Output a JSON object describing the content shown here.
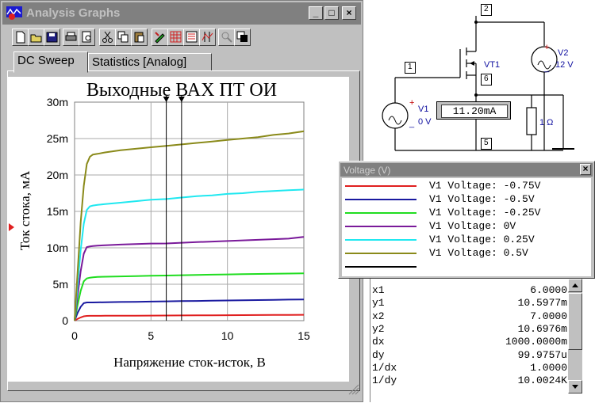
{
  "window": {
    "title": "Analysis Graphs",
    "controls": [
      "_",
      "□",
      "×"
    ]
  },
  "toolbar": {
    "icons": [
      "new-icon",
      "open-icon",
      "save-icon",
      "print-icon",
      "print-preview-icon",
      "cut-icon",
      "copy-icon",
      "paste-icon",
      "properties-icon",
      "grid-icon",
      "legend-icon",
      "cursors-icon",
      "zoom-icon",
      "overlay-icon"
    ]
  },
  "tabs": [
    {
      "label": "DC Sweep",
      "active": true
    },
    {
      "label": "Statistics [Analog]",
      "active": false
    }
  ],
  "chart_data": {
    "type": "line",
    "title": "Выходные ВАХ  ПТ ОИ",
    "xlabel": "Напряжение сток-исток, В",
    "ylabel": "Ток стока, мА",
    "xlim": [
      0,
      15
    ],
    "ylim": [
      0,
      0.03
    ],
    "xticks": [
      "0",
      "5",
      "10",
      "15"
    ],
    "yticks": [
      "0",
      "5m",
      "10m",
      "15m",
      "20m",
      "25m",
      "30m"
    ],
    "grid": true,
    "cursors": [
      6.0,
      7.0
    ],
    "x": [
      0,
      0.2,
      0.4,
      0.6,
      0.8,
      1.0,
      1.2,
      1.5,
      2,
      3,
      4,
      5,
      6,
      7,
      8,
      9,
      10,
      11,
      12,
      13,
      14,
      15
    ],
    "series": [
      {
        "name": "V1 Voltage: -0.75V",
        "color": "#e02020",
        "values": [
          0,
          0.00025,
          0.00045,
          0.0006,
          0.00065,
          0.00066,
          0.00066,
          0.00066,
          0.00067,
          0.00068,
          0.00069,
          0.0007,
          0.00071,
          0.00072,
          0.00073,
          0.00074,
          0.00075,
          0.00076,
          0.00077,
          0.00078,
          0.00079,
          0.0008
        ]
      },
      {
        "name": "V1 Voltage: -0.5V",
        "color": "#1a1aa0",
        "values": [
          0,
          0.0011,
          0.0019,
          0.0024,
          0.0025,
          0.0025,
          0.0025,
          0.00251,
          0.00253,
          0.00256,
          0.00259,
          0.00262,
          0.00265,
          0.00268,
          0.00271,
          0.00274,
          0.00277,
          0.0028,
          0.00283,
          0.00286,
          0.00289,
          0.0029
        ]
      },
      {
        "name": "V1 Voltage: -0.25V",
        "color": "#20dd20",
        "values": [
          0,
          0.0022,
          0.0041,
          0.0054,
          0.0058,
          0.0059,
          0.00595,
          0.006,
          0.00603,
          0.00608,
          0.00612,
          0.00617,
          0.0062,
          0.00624,
          0.00628,
          0.00631,
          0.00635,
          0.00638,
          0.00641,
          0.00644,
          0.00647,
          0.0065
        ]
      },
      {
        "name": "V1 Voltage: 0V",
        "color": "#7a1a9a",
        "values": [
          0,
          0.0035,
          0.0068,
          0.0092,
          0.0101,
          0.0102,
          0.01025,
          0.0103,
          0.01035,
          0.01045,
          0.01052,
          0.01059,
          0.0106,
          0.0107,
          0.01078,
          0.01086,
          0.01094,
          0.01102,
          0.0111,
          0.01118,
          0.01126,
          0.0115
        ]
      },
      {
        "name": "V1 Voltage: 0.25V",
        "color": "#20e8f0",
        "values": [
          0,
          0.005,
          0.0097,
          0.0133,
          0.0152,
          0.0157,
          0.0158,
          0.0159,
          0.016,
          0.0162,
          0.0164,
          0.0166,
          0.0167,
          0.0169,
          0.0171,
          0.0172,
          0.0174,
          0.0175,
          0.0177,
          0.0178,
          0.0179,
          0.018
        ]
      },
      {
        "name": "V1 Voltage: 0.5V",
        "color": "#8a8a1a",
        "values": [
          0,
          0.0068,
          0.0135,
          0.0185,
          0.0215,
          0.0225,
          0.0228,
          0.0229,
          0.0231,
          0.0234,
          0.0236,
          0.0238,
          0.024,
          0.0242,
          0.0244,
          0.0246,
          0.0248,
          0.025,
          0.0252,
          0.0255,
          0.0257,
          0.026
        ]
      }
    ]
  },
  "schematic": {
    "nodes": [
      "2",
      "1",
      "6",
      "5"
    ],
    "vt1": "VT1",
    "v1_name": "V1",
    "v1_value": "0 V",
    "v2_name": "V2",
    "v2_value": "12 V",
    "resistor": "1 Ω",
    "meter": "11.20mA",
    "plus": "+",
    "minus": "_"
  },
  "legend": {
    "title": "Voltage (V)",
    "close": "×",
    "items": [
      {
        "label": "V1 Voltage: -0.75V",
        "color": "#e02020"
      },
      {
        "label": "V1 Voltage: -0.5V",
        "color": "#1a1aa0"
      },
      {
        "label": "V1 Voltage: -0.25V",
        "color": "#20dd20"
      },
      {
        "label": "V1 Voltage: 0V",
        "color": "#7a1a9a"
      },
      {
        "label": "V1 Voltage: 0.25V",
        "color": "#20e8f0"
      },
      {
        "label": "V1 Voltage: 0.5V",
        "color": "#8a8a1a"
      },
      {
        "label": "",
        "color": "#000000"
      }
    ]
  },
  "readout": [
    {
      "key": "x1",
      "value": "6.0000"
    },
    {
      "key": "y1",
      "value": "10.5977m"
    },
    {
      "key": "x2",
      "value": "7.0000"
    },
    {
      "key": "y2",
      "value": "10.6976m"
    },
    {
      "key": "dx",
      "value": "1000.0000m"
    },
    {
      "key": "dy",
      "value": "99.9757u"
    },
    {
      "key": "1/dx",
      "value": "1.0000"
    },
    {
      "key": "1/dy",
      "value": "10.0024K"
    }
  ]
}
